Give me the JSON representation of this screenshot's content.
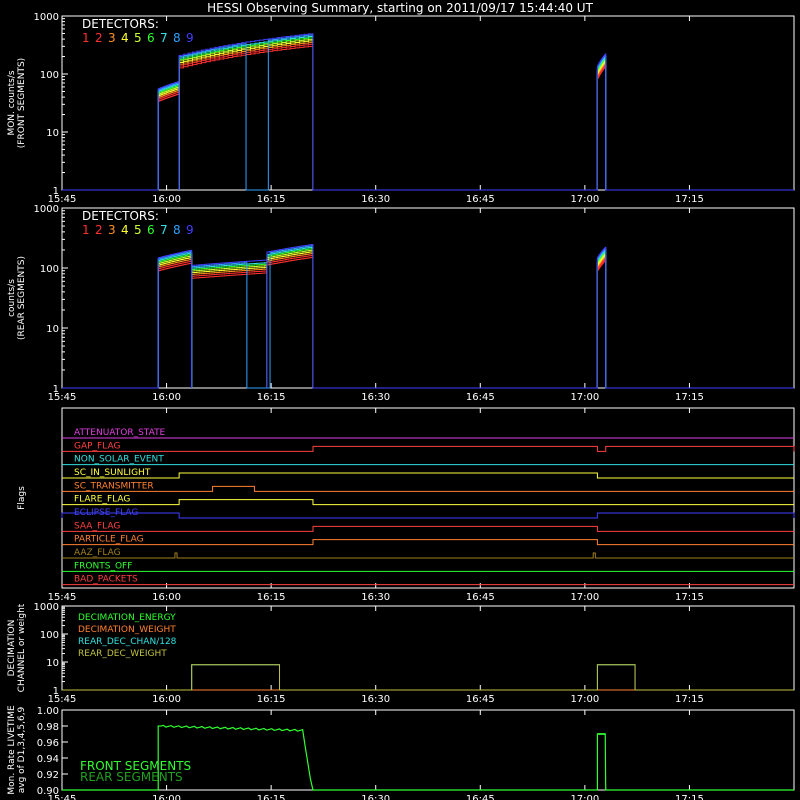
{
  "title": "HESSI Observing Summary, starting on 2011/09/17 15:44:40 UT",
  "detector_colors": [
    "#ff3030",
    "#ff3030",
    "#ff9020",
    "#ffff30",
    "#c8ff30",
    "#30ff30",
    "#30e0e0",
    "#30a0ff",
    "#4040ff"
  ],
  "chart_data": [
    {
      "id": "front",
      "type": "line",
      "ylabel": [
        "MON. counts/s",
        "(FRONT SEGMENTS)"
      ],
      "legend_title": "DETECTORS:",
      "legend_numbers": [
        "1",
        "2",
        "3",
        "4",
        "5",
        "6",
        "7",
        "8",
        "9"
      ],
      "xlim": [
        15.75,
        17.5
      ],
      "x_tick_labels": [
        "15:45",
        "16:00",
        "16:15",
        "16:30",
        "16:45",
        "17:00",
        "17:15"
      ],
      "yscale": "log",
      "ylim": [
        1,
        1000
      ],
      "y_tick_labels": [
        "1",
        "10",
        "100",
        "1000"
      ],
      "series_profile": {
        "segments": [
          {
            "start": 15.98,
            "end": 16.03,
            "values": [
              45,
              60
            ]
          },
          {
            "start": 16.03,
            "end": 16.35,
            "values": [
              170,
              400
            ]
          },
          {
            "start": 17.03,
            "end": 17.05,
            "values": [
              110,
              180
            ]
          }
        ],
        "dropout": {
          "series": 7,
          "start": 16.19,
          "end": 16.25
        }
      }
    },
    {
      "id": "rear",
      "type": "line",
      "ylabel": [
        "counts/s",
        "(REAR SEGMENTS)"
      ],
      "legend_title": "DETECTORS:",
      "legend_numbers": [
        "1",
        "2",
        "3",
        "4",
        "5",
        "6",
        "7",
        "8",
        "9"
      ],
      "xlim": [
        15.75,
        17.5
      ],
      "x_tick_labels": [
        "15:45",
        "16:00",
        "16:15",
        "16:30",
        "16:45",
        "17:00",
        "17:15"
      ],
      "yscale": "log",
      "ylim": [
        1,
        1000
      ],
      "y_tick_labels": [
        "1",
        "10",
        "100",
        "1000"
      ],
      "series_profile": {
        "segments": [
          {
            "start": 15.98,
            "end": 16.06,
            "values": [
              120,
              160
            ]
          },
          {
            "start": 16.06,
            "end": 16.24,
            "values": [
              90,
              110
            ]
          },
          {
            "start": 16.24,
            "end": 16.35,
            "values": [
              150,
              200
            ]
          },
          {
            "start": 17.03,
            "end": 17.05,
            "values": [
              120,
              180
            ]
          }
        ],
        "dropout": {
          "series": 7,
          "start": 16.19,
          "end": 16.25
        }
      }
    },
    {
      "id": "flags",
      "type": "line",
      "ylabel": [
        "Flags"
      ],
      "xlim": [
        15.75,
        17.5
      ],
      "x_tick_labels": [
        "15:45",
        "16:00",
        "16:15",
        "16:30",
        "16:45",
        "17:00",
        "17:15"
      ],
      "series": [
        {
          "name": "ATTENUATOR_STATE",
          "color": "#e040e0",
          "steps": []
        },
        {
          "name": "GAP_FLAG",
          "color": "#ff4040",
          "steps": [
            [
              16.35,
              17.03
            ],
            [
              17.05,
              17.5
            ]
          ]
        },
        {
          "name": "NON_SOLAR_EVENT",
          "color": "#30e0e0",
          "steps": []
        },
        {
          "name": "SC_IN_SUNLIGHT",
          "color": "#ffff40",
          "steps": [
            [
              16.03,
              17.03
            ]
          ]
        },
        {
          "name": "SC_TRANSMITTER",
          "color": "#ff8030",
          "steps": [
            [
              16.11,
              16.21
            ]
          ]
        },
        {
          "name": "FLARE_FLAG",
          "color": "#ffff40",
          "steps": [
            [
              16.03,
              16.35
            ]
          ]
        },
        {
          "name": "ECLIPSE_FLAG",
          "color": "#4040ff",
          "steps": [
            [
              15.75,
              16.03
            ],
            [
              17.03,
              17.5
            ]
          ]
        },
        {
          "name": "SAA_FLAG",
          "color": "#ff4040",
          "steps": [
            [
              16.35,
              17.03
            ]
          ]
        },
        {
          "name": "PARTICLE_FLAG",
          "color": "#ff8030",
          "steps": [
            [
              16.35,
              17.03
            ]
          ]
        },
        {
          "name": "AAZ_FLAG",
          "color": "#a08020",
          "steps": [
            [
              16.02,
              16.025
            ],
            [
              17.02,
              17.025
            ]
          ]
        },
        {
          "name": "FRONTS_OFF",
          "color": "#30ff30",
          "steps": []
        },
        {
          "name": "BAD_PACKETS",
          "color": "#ff4040",
          "steps": []
        }
      ]
    },
    {
      "id": "decimation",
      "type": "line",
      "ylabel": [
        "DECIMATION",
        "CHANNEL or weight"
      ],
      "xlim": [
        15.75,
        17.5
      ],
      "x_tick_labels": [
        "15:45",
        "16:00",
        "16:15",
        "16:30",
        "16:45",
        "17:00",
        "17:15"
      ],
      "yscale": "log",
      "ylim": [
        1,
        1000
      ],
      "y_tick_labels": [
        "1",
        "10",
        "100",
        "1000"
      ],
      "series": [
        {
          "name": "DECIMATION_ENERGY",
          "color": "#30ff30"
        },
        {
          "name": "DECIMATION_WEIGHT",
          "color": "#ff8030"
        },
        {
          "name": "REAR_DEC_CHAN/128",
          "color": "#30e0e0"
        },
        {
          "name": "REAR_DEC_WEIGHT",
          "color": "#c0c040"
        }
      ],
      "steps": [
        [
          16.06,
          16.27,
          8
        ],
        [
          17.03,
          17.12,
          8
        ]
      ]
    },
    {
      "id": "livetime",
      "type": "line",
      "ylabel": [
        "Mon. Rate LIVETIME",
        "avg of D1,3,4,5,6,9"
      ],
      "xlim": [
        15.75,
        17.5
      ],
      "x_tick_labels": [
        "15:45",
        "16:00",
        "16:15",
        "16:30",
        "16:45",
        "17:00",
        "17:15"
      ],
      "ylim": [
        0.9,
        1.0
      ],
      "y_tick_labels": [
        "0.90",
        "0.92",
        "0.94",
        "0.96",
        "0.98",
        "1.00"
      ],
      "legend": [
        "FRONT SEGMENTS",
        "REAR SEGMENTS"
      ],
      "legend_colors": [
        "#30ff30",
        "#20a020"
      ],
      "segments": [
        [
          15.98,
          16.35,
          0.98,
          0.974
        ],
        [
          17.03,
          17.05,
          0.97,
          0.97
        ]
      ]
    }
  ]
}
